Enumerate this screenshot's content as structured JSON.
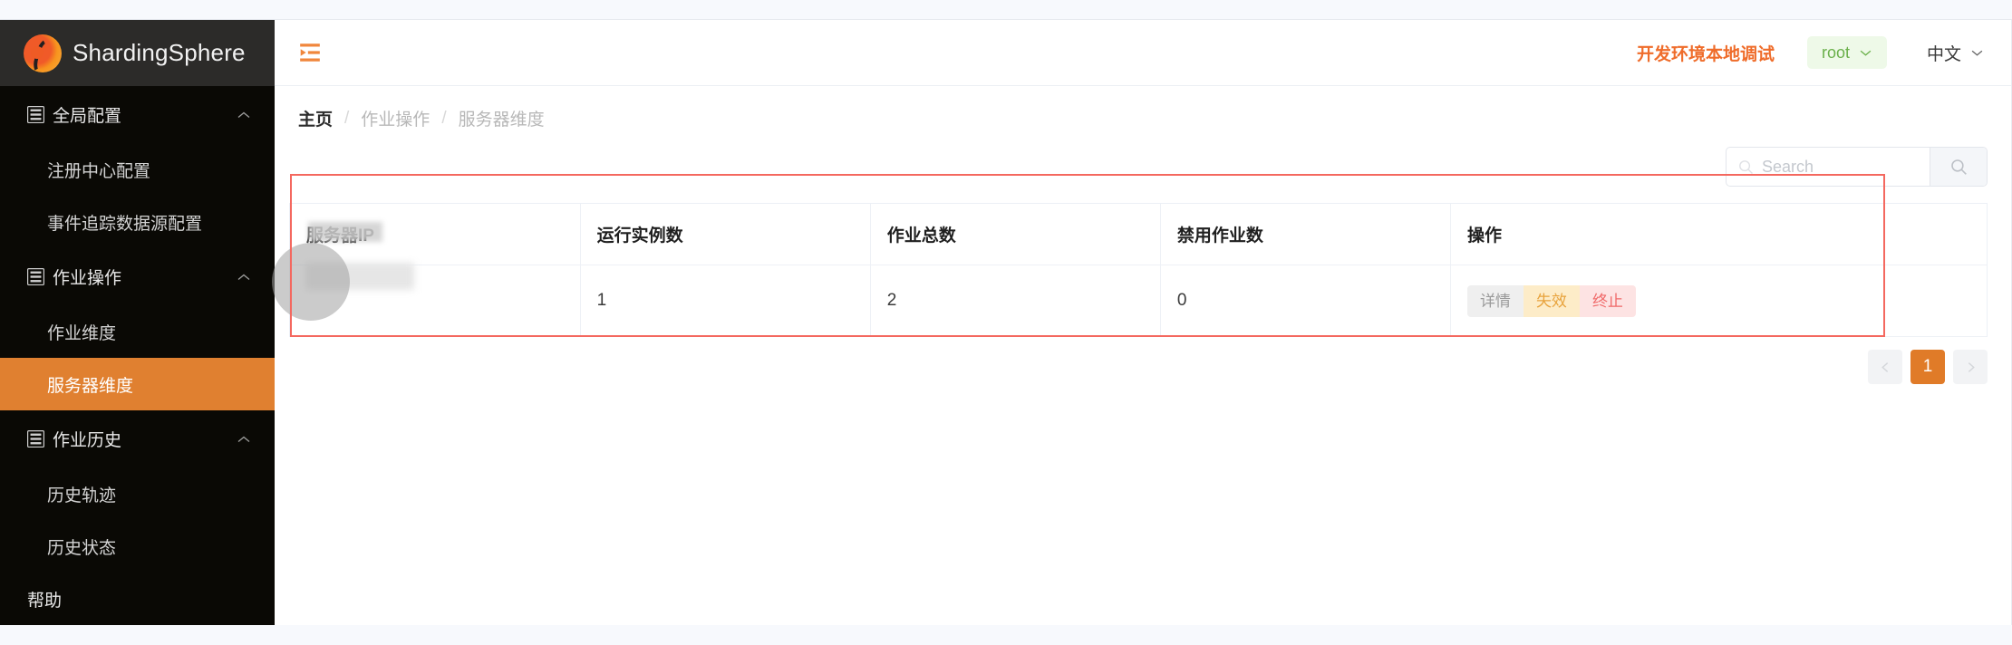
{
  "brand": {
    "name": "ShardingSphere",
    "logo_icon": "shardingsphere-logo"
  },
  "sidebar": {
    "groups": [
      {
        "label": "全局配置",
        "icon": "list-menu-icon",
        "chevron": "chevron-up-icon",
        "items": [
          {
            "label": "注册中心配置",
            "active": false
          },
          {
            "label": "事件追踪数据源配置",
            "active": false
          }
        ]
      },
      {
        "label": "作业操作",
        "icon": "list-menu-icon",
        "chevron": "chevron-up-icon",
        "items": [
          {
            "label": "作业维度",
            "active": false
          },
          {
            "label": "服务器维度",
            "active": true
          }
        ]
      },
      {
        "label": "作业历史",
        "icon": "list-menu-icon",
        "chevron": "chevron-up-icon",
        "items": [
          {
            "label": "历史轨迹",
            "active": false
          },
          {
            "label": "历史状态",
            "active": false
          }
        ]
      }
    ],
    "help_label": "帮助"
  },
  "topbar": {
    "fold_icon": "menu-fold-icon",
    "env_label": "开发环境本地调试",
    "user": {
      "name": "root",
      "chevron": "chevron-down-icon"
    },
    "language": {
      "label": "中文",
      "chevron": "chevron-down-icon"
    }
  },
  "breadcrumb": [
    {
      "label": "主页"
    },
    {
      "label": "作业操作"
    },
    {
      "label": "服务器维度"
    }
  ],
  "breadcrumb_separator": "/",
  "search": {
    "placeholder": "Search",
    "value": "",
    "input_icon": "search-icon",
    "button_icon": "search-icon"
  },
  "table": {
    "columns": [
      "服务器IP",
      "运行实例数",
      "作业总数",
      "禁用作业数",
      "操作"
    ],
    "rows": [
      {
        "server_ip": "",
        "running_instances": "1",
        "total_jobs": "2",
        "disabled_jobs": "0",
        "actions": [
          {
            "label": "详情",
            "kind": "detail"
          },
          {
            "label": "失效",
            "kind": "disable"
          },
          {
            "label": "终止",
            "kind": "stop"
          }
        ]
      }
    ]
  },
  "pagination": {
    "prev_icon": "chevron-left-icon",
    "next_icon": "chevron-right-icon",
    "pages": [
      "1"
    ],
    "current": "1"
  },
  "colors": {
    "accent_orange": "#e07b28",
    "env_orange": "#ef6c2a",
    "sidebar_bg": "#0a0905",
    "brand_bar_bg": "#2c2b29",
    "user_green": "#6ab04a",
    "annotation_red": "#f4685f"
  }
}
